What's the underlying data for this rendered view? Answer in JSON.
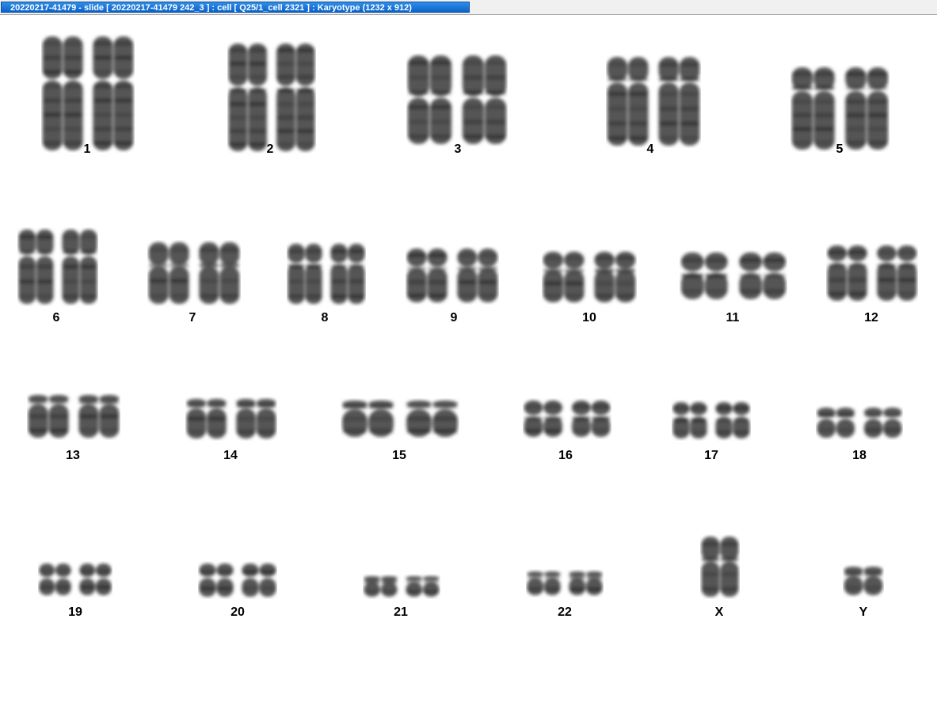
{
  "window": {
    "title": "20220217-41479 - slide [ 20220217-41479 242_3 ] : cell [ Q25/1_cell 2321 ] : Karyotype  (1232 x 912)"
  },
  "karyotype": {
    "labels": {
      "c1": "1",
      "c2": "2",
      "c3": "3",
      "c4": "4",
      "c5": "5",
      "c6": "6",
      "c7": "7",
      "c8": "8",
      "c9": "9",
      "c10": "10",
      "c11": "11",
      "c12": "12",
      "c13": "13",
      "c14": "14",
      "c15": "15",
      "c16": "16",
      "c17": "17",
      "c18": "18",
      "c19": "19",
      "c20": "20",
      "c21": "21",
      "c22": "22",
      "cX": "X",
      "cY": "Y"
    },
    "chromosome_color": "#555555",
    "band_color": "#2a2a2a"
  }
}
